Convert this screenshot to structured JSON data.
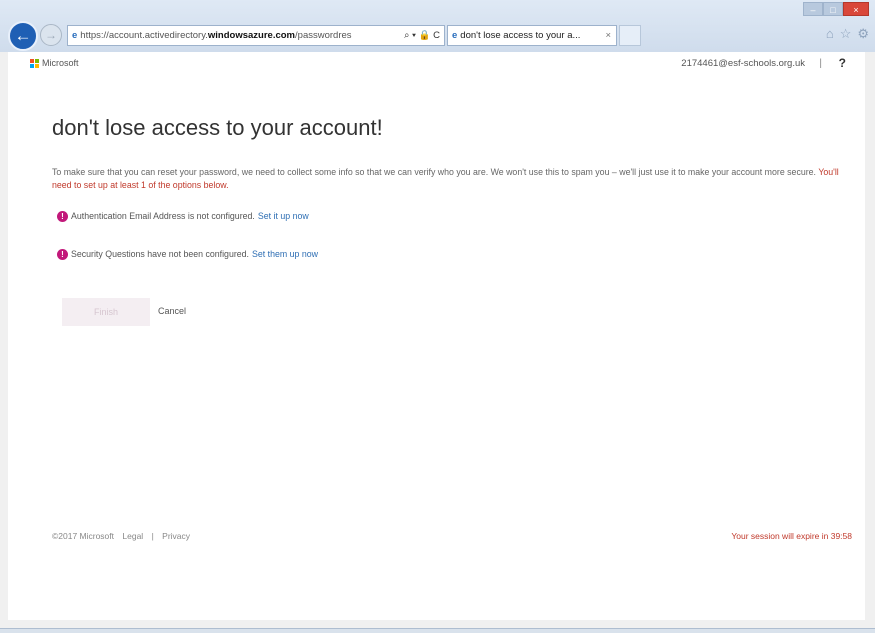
{
  "browser": {
    "address": {
      "scheme": "https://",
      "host_pre": "account.activedirectory.",
      "host_main": "windowsazure.com",
      "path": "/passwordres",
      "controls": "⌕ ▾ 🔒 C"
    },
    "tab": {
      "title": "don't lose access to your a...",
      "close": "×"
    },
    "window_buttons": {
      "minimize": "–",
      "maximize": "□",
      "close": "×"
    },
    "icons": [
      "home-icon",
      "star-icon",
      "gear-icon"
    ]
  },
  "header": {
    "brand": "Microsoft",
    "user_email": "2174461@esf-schools.org.uk",
    "separator": "|",
    "help": "?"
  },
  "main": {
    "title": "don't lose access to your account!",
    "intro": "To make sure that you can reset your password, we need to collect some info so that we can verify who you are. We won't use this to spam you – we'll just use it to make your account more secure.",
    "intro_required": "You'll need to set up at least 1 of the options below.",
    "items": [
      {
        "text": "Authentication Email Address is not configured.",
        "link": "Set it up now"
      },
      {
        "text": "Security Questions have not been configured.",
        "link": "Set them up now"
      }
    ],
    "finish_label": "Finish",
    "cancel_label": "Cancel"
  },
  "footer": {
    "copyright": "©2017 Microsoft",
    "legal": "Legal",
    "separator": "|",
    "privacy": "Privacy",
    "session": "Your session will expire in 39:58"
  },
  "colors": {
    "accent_link": "#2f6fb4",
    "alert": "#c2187a",
    "warning_text": "#c0392b",
    "back_button": "#1f5fb4"
  }
}
